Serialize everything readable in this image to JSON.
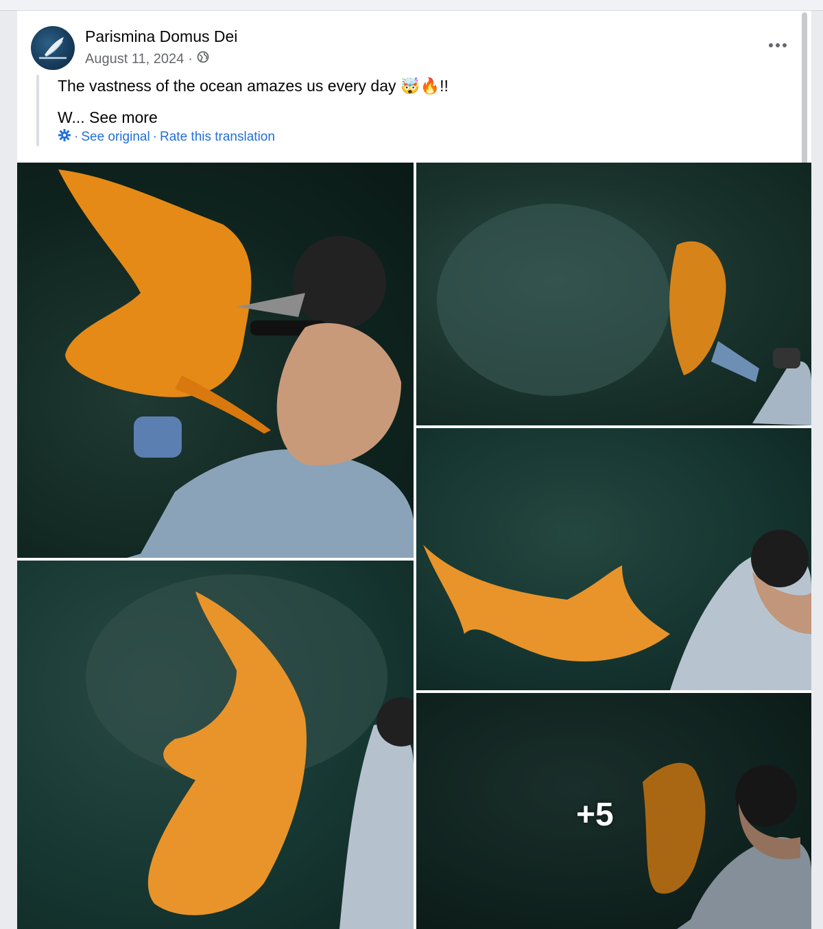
{
  "post": {
    "author": "Parismina Domus Dei",
    "date": "August 11, 2024",
    "separator": "·",
    "text_line1": "The vastness of the ocean amazes us every day 🤯🔥!!",
    "text_truncated": "W...",
    "see_more": "See more",
    "see_original": "See original",
    "rate_translation": "Rate this translation",
    "more_count": "+5"
  },
  "icons": {
    "privacy": "globe-icon",
    "options": "more-horizontal-icon",
    "translation": "gear-icon"
  },
  "colors": {
    "link": "#216fdb",
    "meta": "#65676b",
    "shark": "#e58a16",
    "water": "#173832"
  }
}
